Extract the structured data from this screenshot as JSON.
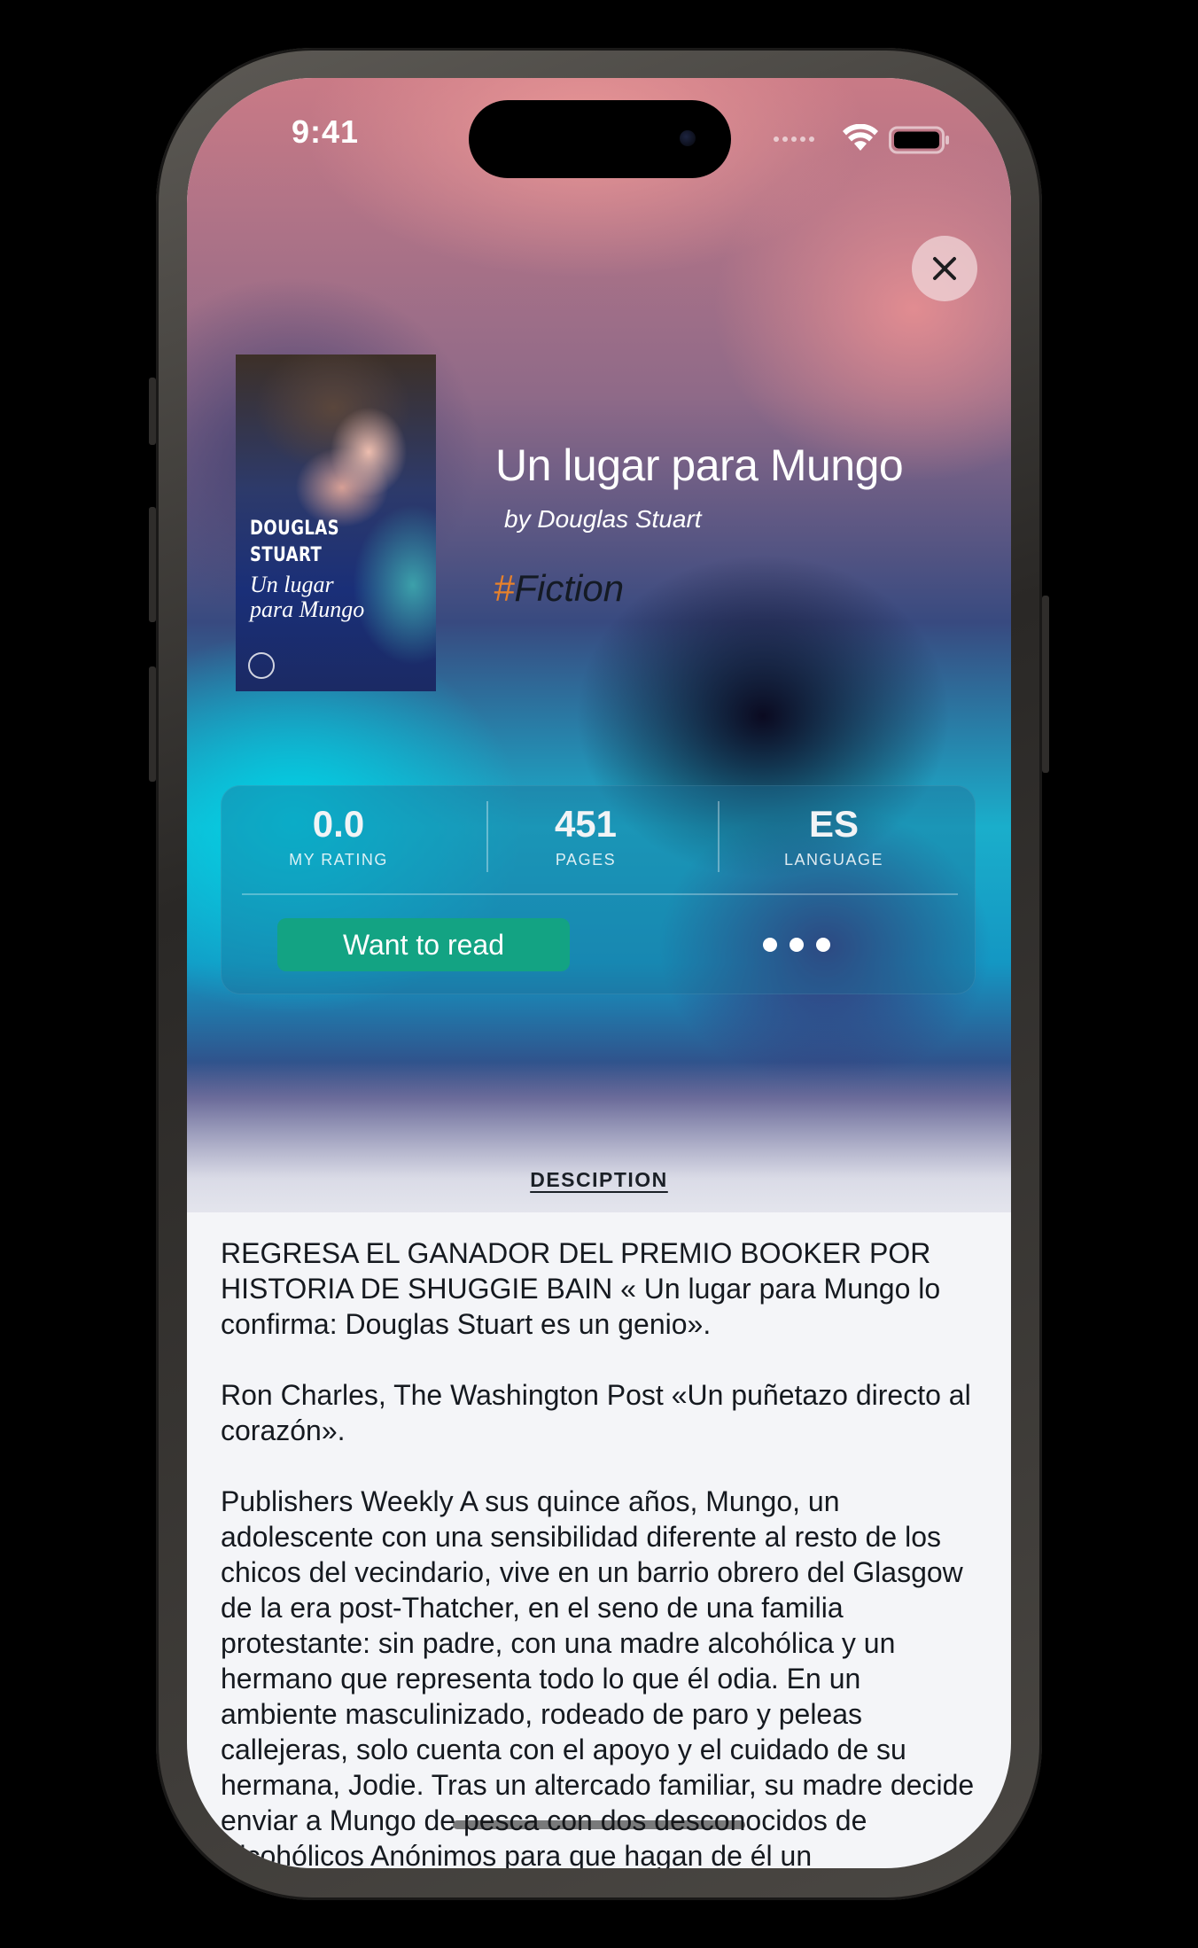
{
  "status_bar": {
    "time": "9:41"
  },
  "header": {
    "close_icon": "close-icon"
  },
  "book": {
    "title": "Un lugar para Mungo",
    "author_line": "by Douglas Stuart",
    "genre_hash": "#",
    "genre": "Fiction",
    "cover": {
      "author_text": "DOUGLAS\nSTUART",
      "title_text": "Un lugar\npara Mungo"
    }
  },
  "stats": {
    "rating": {
      "value": "0.0",
      "label": "MY RATING"
    },
    "pages": {
      "value": "451",
      "label": "PAGES"
    },
    "language": {
      "value": "ES",
      "label": "LANGUAGE"
    }
  },
  "actions": {
    "want_to_read": "Want to read",
    "more_icon": "ellipsis-icon"
  },
  "description": {
    "heading": "DESCIPTION",
    "body": "REGRESA EL GANADOR DEL PREMIO BOOKER POR HISTORIA DE SHUGGIE BAIN « Un lugar para Mungo lo confirma: Douglas Stuart es un genio».\n\nRon Charles, The Washington Post «Un puñetazo directo al corazón».\n\nPublishers Weekly A sus quince años, Mungo, un adolescente con una sensibilidad diferente al resto de los chicos del vecindario, vive en un barrio obrero del Glasgow de la era post-Thatcher, en el seno de una familia protestante: sin padre, con una madre alcohólica y un hermano que representa todo lo que él odia. En un ambiente masculinizado, rodeado de paro y peleas callejeras, solo cuenta con el apoyo y el cuidado de su hermana, Jodie. Tras un altercado familiar, su madre decide enviar a Mungo de pesca con dos desconocidos de Alcohólicos Anónimos para que hagan de él un"
  },
  "colors": {
    "accent_green": "#13a383",
    "genre_hash": "#e8812a"
  }
}
